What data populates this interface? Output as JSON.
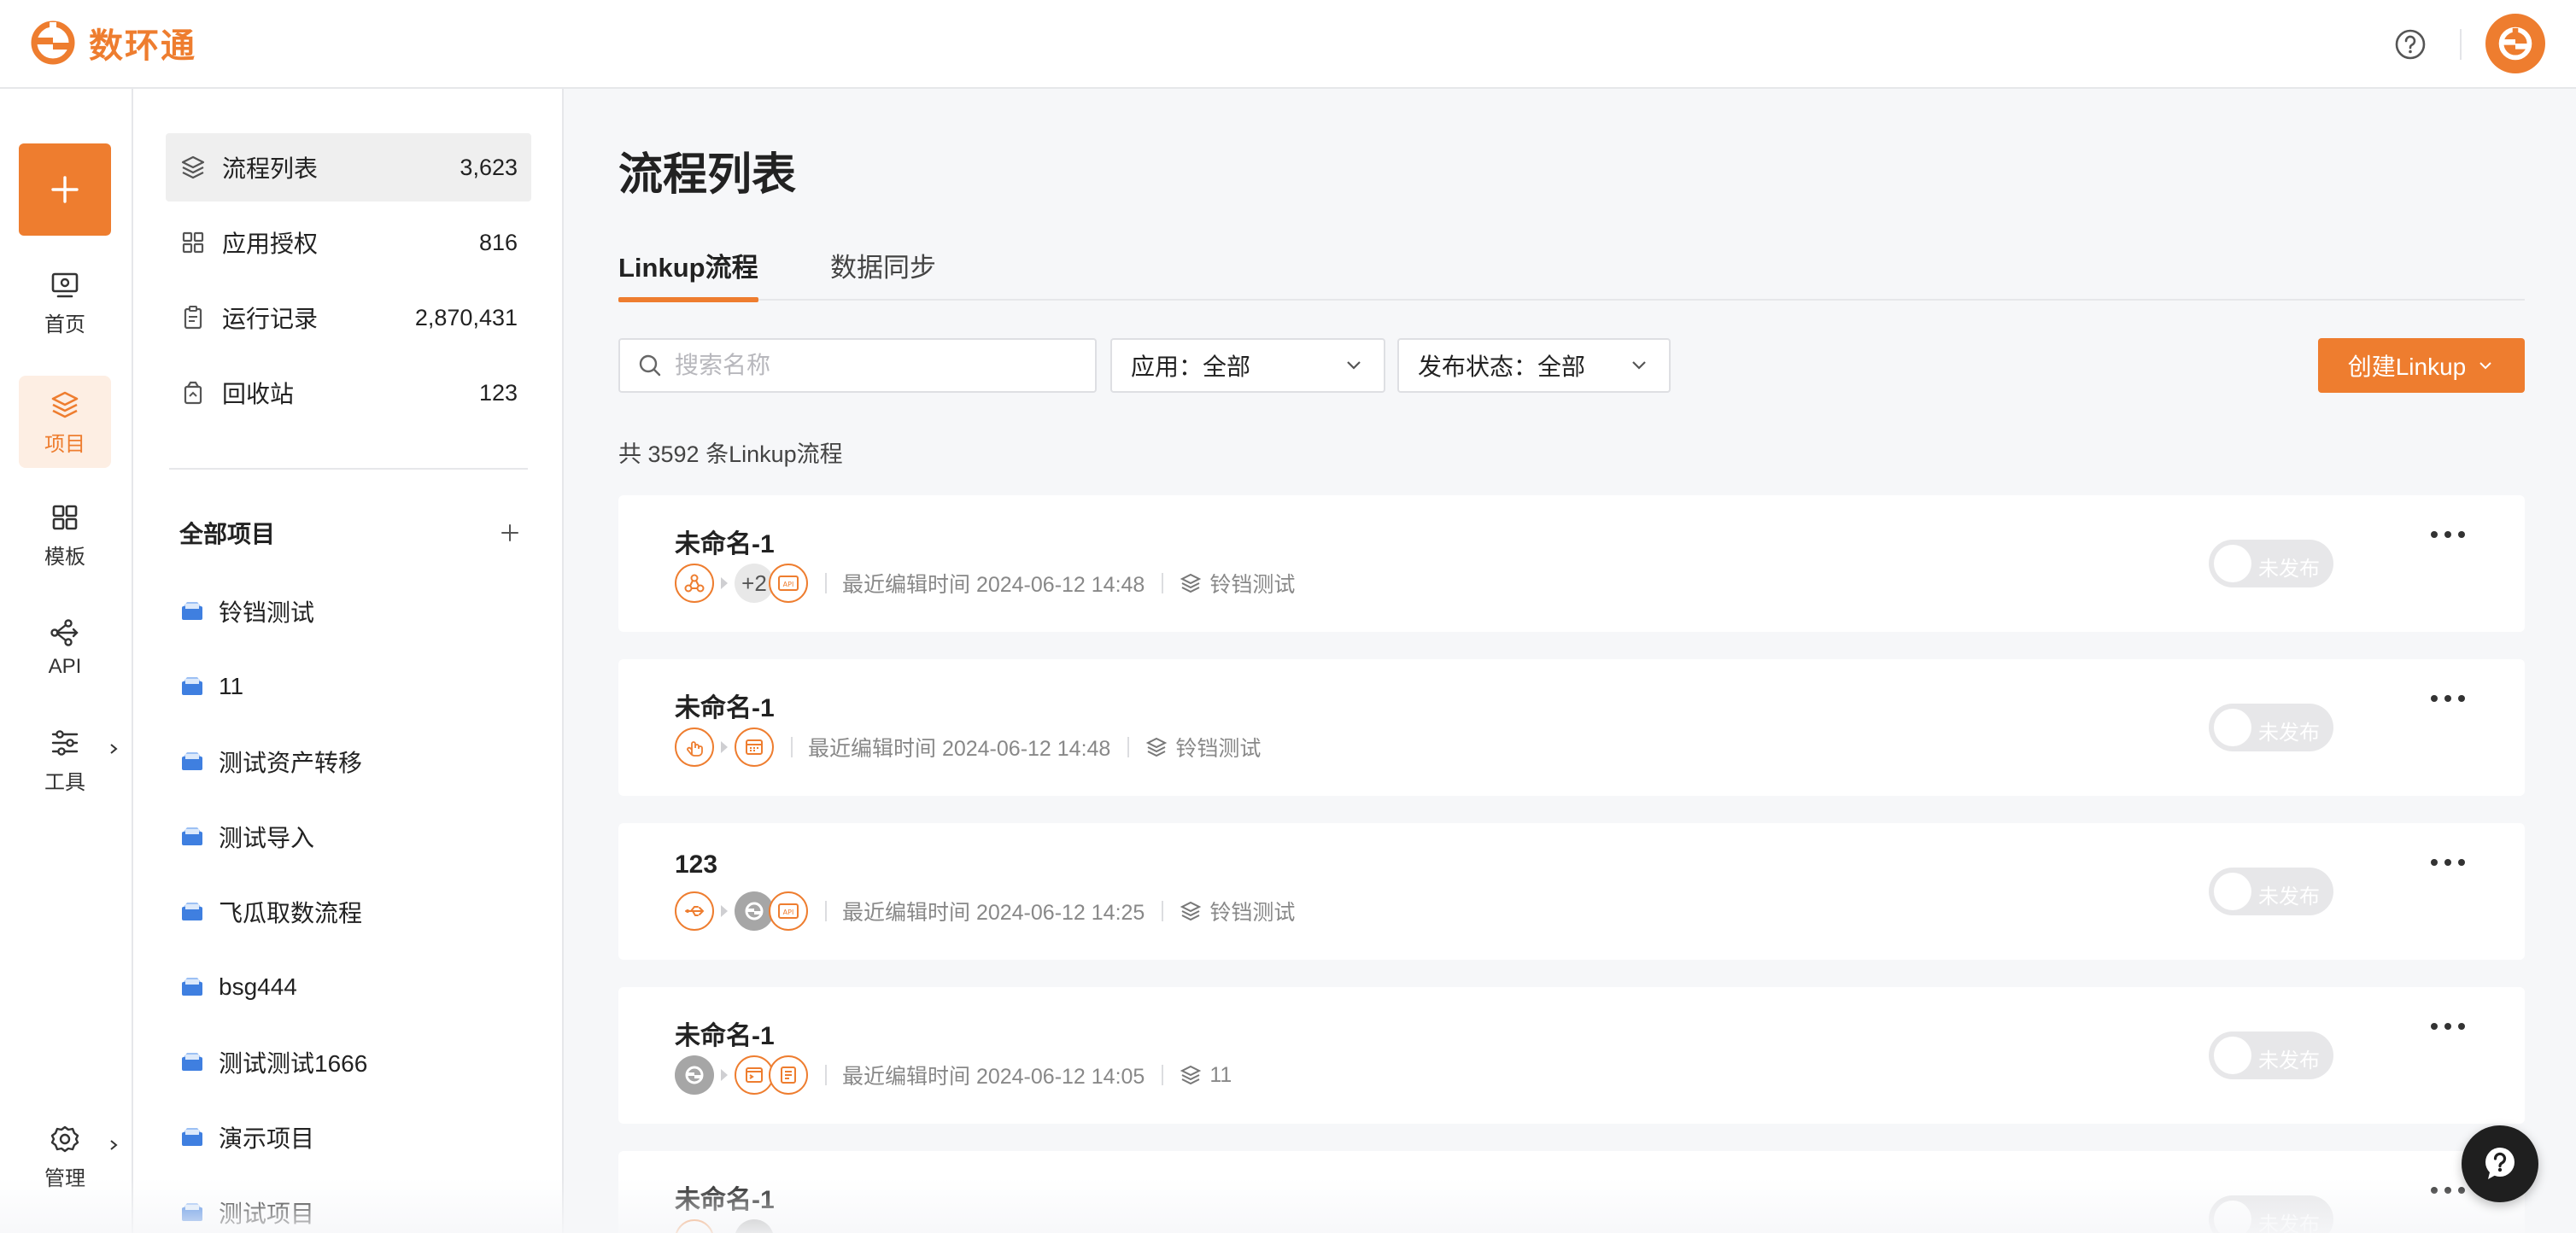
{
  "brand": {
    "name": "数环通",
    "accent": "#ee7d2f"
  },
  "leftnav": {
    "items": [
      {
        "label": "首页",
        "icon": "monitor-icon"
      },
      {
        "label": "项目",
        "icon": "layers-icon",
        "active": true
      },
      {
        "label": "模板",
        "icon": "grid-icon"
      },
      {
        "label": "API",
        "icon": "api-icon"
      },
      {
        "label": "工具",
        "icon": "sliders-icon"
      },
      {
        "label": "管理",
        "icon": "gear-icon"
      }
    ]
  },
  "panel": {
    "items": [
      {
        "label": "流程列表",
        "count": "3,623",
        "icon": "layers-icon"
      },
      {
        "label": "应用授权",
        "count": "816",
        "icon": "grid-icon"
      },
      {
        "label": "运行记录",
        "count": "2,870,431",
        "icon": "clipboard-icon"
      },
      {
        "label": "回收站",
        "count": "123",
        "icon": "trash-icon"
      }
    ],
    "all_projects": "全部项目",
    "projects": [
      "铃铛测试",
      "11",
      "测试资产转移",
      "测试导入",
      "飞瓜取数流程",
      "bsg444",
      "测试测试1666",
      "演示项目",
      "测试项目"
    ]
  },
  "main": {
    "title": "流程列表",
    "tabs": [
      "Linkup流程",
      "数据同步"
    ],
    "search_placeholder": "搜索名称",
    "filter_app": "应用：全部",
    "filter_status": "发布状态：全部",
    "create_label": "创建Linkup",
    "total": "共 3592 条Linkup流程"
  },
  "flows": [
    {
      "name": "未命名-1",
      "edited": "最近编辑时间 2024-06-12 14:48",
      "project": "铃铛测试",
      "status": "未发布",
      "extra": "+2"
    },
    {
      "name": "未命名-1",
      "edited": "最近编辑时间 2024-06-12 14:48",
      "project": "铃铛测试",
      "status": "未发布"
    },
    {
      "name": "123",
      "edited": "最近编辑时间 2024-06-12 14:25",
      "project": "铃铛测试",
      "status": "未发布"
    },
    {
      "name": "未命名-1",
      "edited": "最近编辑时间 2024-06-12 14:05",
      "project": "11",
      "status": "未发布"
    },
    {
      "name": "未命名-1",
      "status": "未发布"
    }
  ]
}
